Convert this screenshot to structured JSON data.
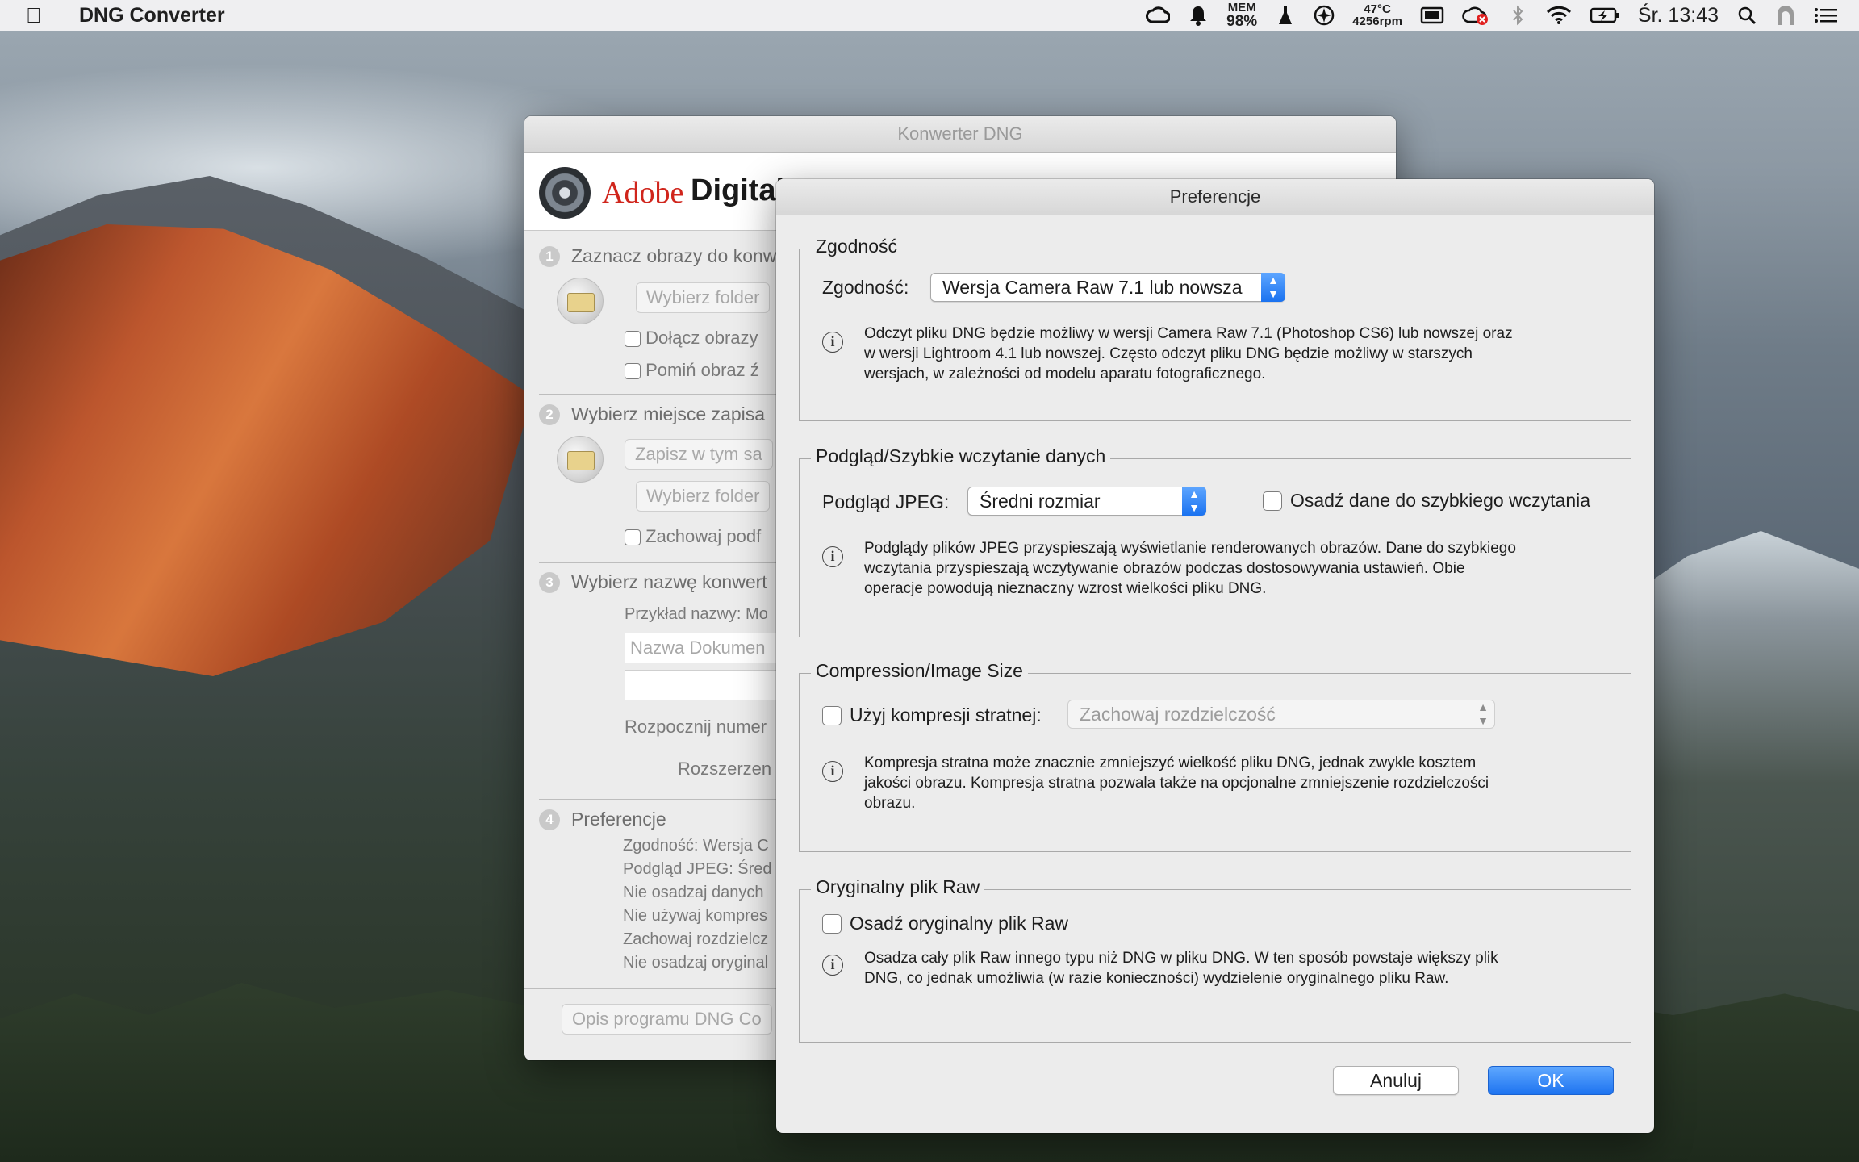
{
  "menubar": {
    "app_name": "DNG Converter",
    "mem_label": "MEM",
    "mem_value": "98%",
    "temp": "47°C",
    "fan": "4256rpm",
    "clock": "Śr. 13:43"
  },
  "main_window": {
    "title": "Konwerter DNG",
    "banner_adobe": "Adobe",
    "banner_digital": "Digital",
    "steps": [
      {
        "num": "1",
        "label": "Zaznacz obrazy do konw"
      },
      {
        "num": "2",
        "label": "Wybierz miejsce zapisa"
      },
      {
        "num": "3",
        "label": "Wybierz nazwę konwert"
      },
      {
        "num": "4",
        "label": "Preferencje"
      }
    ],
    "select_folder_1": "Wybierz folder",
    "include_images": "Dołącz obrazy",
    "skip_image": "Pomiń obraz ź",
    "save_same": "Zapisz w tym sa",
    "select_folder_2": "Wybierz folder",
    "keep_sub": "Zachowaj podf",
    "name_example": "Przykład nazwy:  Mo",
    "doc_name": "Nazwa Dokumen",
    "start_numbering": "Rozpocznij numer",
    "extension": "Rozszerzen",
    "pref_summary": [
      "Zgodność: Wersja C",
      "Podgląd JPEG: Śred",
      "Nie osadzaj danych",
      "Nie używaj kompres",
      "Zachowaj rozdzielcz",
      "Nie osadzaj oryginal"
    ],
    "about_btn": "Opis programu DNG Co"
  },
  "preferences": {
    "title": "Preferencje",
    "compat": {
      "legend": "Zgodność",
      "label": "Zgodność:",
      "value": "Wersja Camera Raw 7.1 lub nowsza",
      "info": [
        "Odczyt pliku DNG będzie możliwy w wersji Camera Raw 7.1 (Photoshop CS6) lub nowszej oraz",
        "w wersji Lightroom 4.1 lub nowszej. Często odczyt pliku DNG będzie możliwy w starszych",
        "wersjach, w zależności od modelu aparatu fotograficznego."
      ]
    },
    "preview": {
      "legend": "Podgląd/Szybkie wczytanie danych",
      "jpeg_label": "Podgląd JPEG:",
      "jpeg_value": "Średni rozmiar",
      "embed_fast_label": "Osadź dane do szybkiego wczytania",
      "embed_fast_checked": false,
      "info": [
        "Podglądy plików JPEG przyspieszają wyświetlanie renderowanych obrazów. Dane do szybkiego",
        "wczytania przyspieszają wczytywanie obrazów podczas dostosowywania ustawień. Obie",
        "operacje powodują nieznaczny wzrost wielkości pliku DNG."
      ]
    },
    "compression": {
      "legend": "Compression/Image Size",
      "lossy_label": "Użyj kompresji stratnej:",
      "lossy_checked": false,
      "resolution_value": "Zachowaj rozdzielczość",
      "info": [
        "Kompresja stratna może znacznie zmniejszyć wielkość pliku DNG, jednak zwykle kosztem",
        "jakości obrazu. Kompresja stratna pozwala także na opcjonalne zmniejszenie rozdzielczości",
        "obrazu."
      ]
    },
    "original": {
      "legend": "Oryginalny plik Raw",
      "embed_label": "Osadź oryginalny plik Raw",
      "embed_checked": false,
      "info": [
        "Osadza cały plik Raw innego typu niż DNG w pliku DNG.  W ten sposób powstaje większy plik",
        "DNG, co jednak umożliwia (w razie konieczności) wydzielenie oryginalnego pliku Raw."
      ]
    },
    "cancel_label": "Anuluj",
    "ok_label": "OK"
  }
}
